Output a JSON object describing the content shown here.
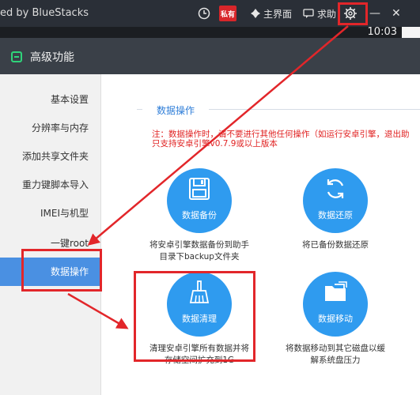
{
  "titlebar": {
    "brand": "ed by BlueStacks",
    "app_badge": "私有",
    "home_label": "主界面",
    "help_label": "求助",
    "min_glyph": "—",
    "close_glyph": "✕"
  },
  "status": {
    "clock": "10:03"
  },
  "dialog": {
    "title": "高级功能"
  },
  "sidebar": {
    "items": [
      {
        "label": "基本设置"
      },
      {
        "label": "分辨率与内存"
      },
      {
        "label": "添加共享文件夹"
      },
      {
        "label": "重力键脚本导入"
      },
      {
        "label": "IMEI与机型"
      },
      {
        "label": "一键root"
      },
      {
        "label": "数据操作"
      }
    ]
  },
  "content": {
    "section_title": "数据操作",
    "notice_line1": "注：数据操作时，请不要进行其他任何操作（如运行安卓引擎，退出助",
    "notice_line2": "只支持安卓引擎v0.7.9或以上版本",
    "ops": [
      {
        "label": "数据备份",
        "desc1": "将安卓引擎数据备份到助手",
        "desc2": "目录下backup文件夹",
        "icon": "floppy-disk-icon"
      },
      {
        "label": "数据还原",
        "desc1": "将已备份数据还原",
        "desc2": "",
        "icon": "restore-icon"
      },
      {
        "label": "数据清理",
        "desc1": "清理安卓引擎所有数据并将",
        "desc2": "存储空间扩充到1G",
        "icon": "broom-icon"
      },
      {
        "label": "数据移动",
        "desc1": "将数据移动到其它磁盘以缓",
        "desc2": "解系统盘压力",
        "icon": "folder-move-icon"
      }
    ]
  },
  "colors": {
    "accent": "#2f9bef",
    "sidebar_active": "#4a90e2",
    "annotation": "#e2262a",
    "notice": "#e02020"
  }
}
